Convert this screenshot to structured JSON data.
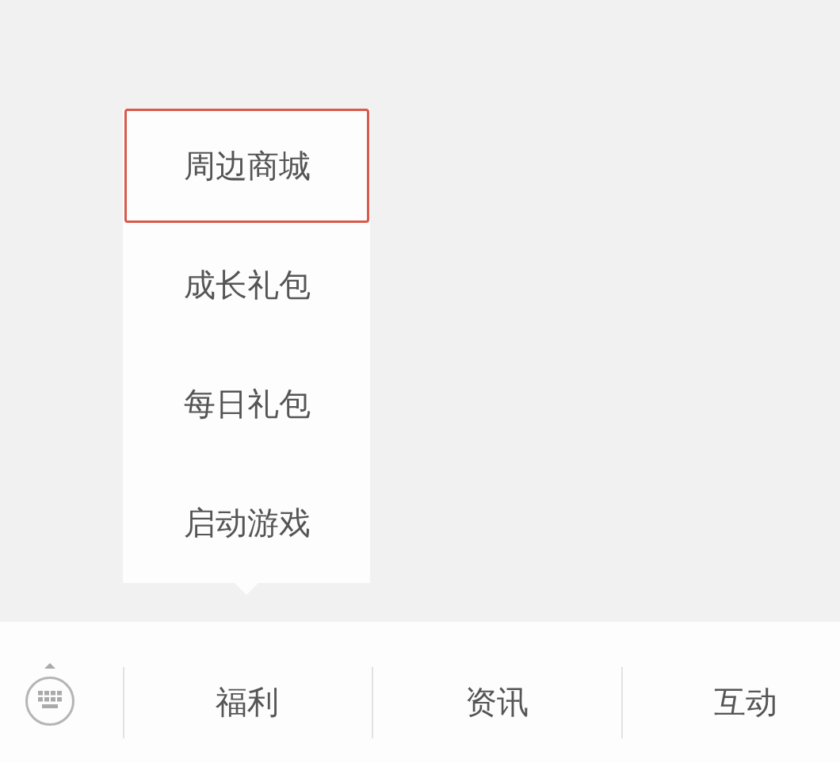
{
  "menu": {
    "items": [
      {
        "label": "周边商城",
        "selected": true
      },
      {
        "label": "成长礼包",
        "selected": false
      },
      {
        "label": "每日礼包",
        "selected": false
      },
      {
        "label": "启动游戏",
        "selected": false
      }
    ]
  },
  "tab_bar": {
    "tabs": [
      {
        "label": "福利",
        "expanded": true
      },
      {
        "label": "资讯",
        "expanded": false
      },
      {
        "label": "互动",
        "expanded": false
      }
    ]
  }
}
